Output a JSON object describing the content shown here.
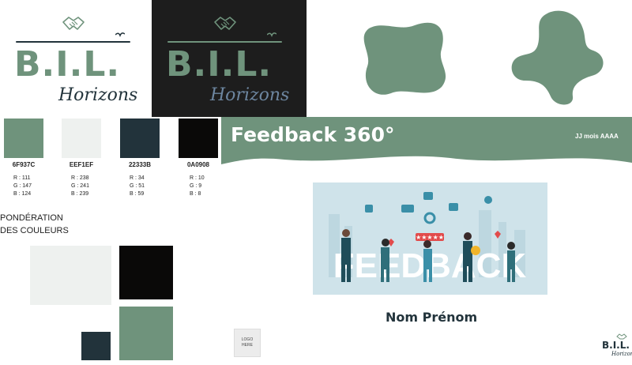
{
  "brand": {
    "logo_main": "B.I.L.",
    "logo_sub": "Horizons",
    "logo_icon": "handshake-icon",
    "logo_bird_icon": "bird-icon"
  },
  "palette": [
    {
      "hex": "6F937C",
      "r": "R : 111",
      "g": "G : 147",
      "b": "B : 124",
      "color": "#6F937C"
    },
    {
      "hex": "EEF1EF",
      "r": "R : 238",
      "g": "G : 241",
      "b": "B : 239",
      "color": "#EEF1EF"
    },
    {
      "hex": "22333B",
      "r": "R : 34",
      "g": "G : 51",
      "b": "B : 59",
      "color": "#22333B"
    },
    {
      "hex": "0A0908",
      "r": "R : 10",
      "g": "G : 9",
      "b": "B : 8",
      "color": "#0A0908"
    }
  ],
  "ponderation": {
    "line1": "PONDÉRATION",
    "line2": "DES COULEURS"
  },
  "slide": {
    "title": "Feedback 360°",
    "date": "JJ mois AAAA",
    "illustration_word": "FEEDBACK",
    "name": "Nom Prénom",
    "logo_placeholder_line1": "LOGO",
    "logo_placeholder_line2": "HERE",
    "mini_logo_main": "B.I.L.",
    "mini_logo_sub": "Horizons"
  }
}
